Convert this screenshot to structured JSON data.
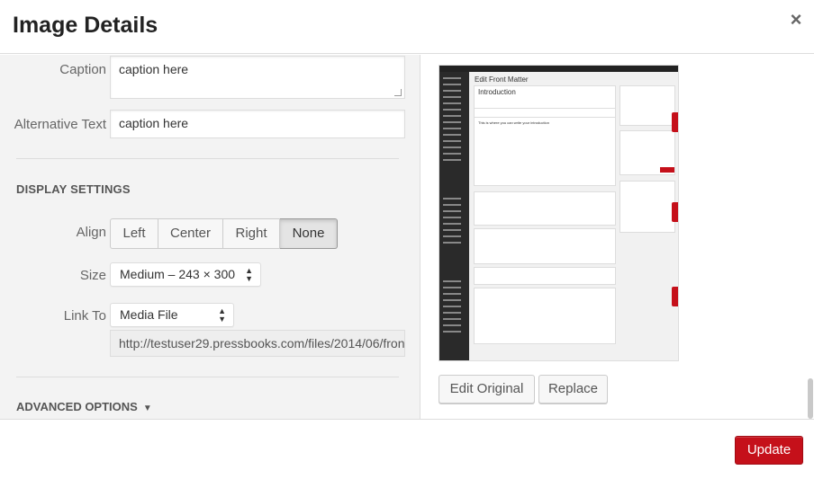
{
  "dialog": {
    "title": "Image Details",
    "close_icon": "×"
  },
  "caption": {
    "label": "Caption",
    "value": "caption here"
  },
  "alt_text": {
    "label": "Alternative Text",
    "value": "caption here"
  },
  "display_settings": {
    "heading": "DISPLAY SETTINGS",
    "align": {
      "label": "Align",
      "options": [
        "Left",
        "Center",
        "Right",
        "None"
      ],
      "selected": "None"
    },
    "size": {
      "label": "Size",
      "value": "Medium – 243 × 300"
    },
    "link_to": {
      "label": "Link To",
      "value": "Media File",
      "url": "http://testuser29.pressbooks.com/files/2014/06/fron"
    }
  },
  "advanced_options": {
    "label": "ADVANCED OPTIONS",
    "toggle_icon": "▼"
  },
  "preview": {
    "page_heading": "Edit Front Matter",
    "post_title": "Introduction",
    "body_text": "This is where you can write your introduction",
    "actions": {
      "edit_original": "Edit Original",
      "replace": "Replace"
    }
  },
  "footer": {
    "update_label": "Update"
  },
  "colors": {
    "accent": "#c5101a",
    "panel_bg": "#f3f3f3"
  }
}
